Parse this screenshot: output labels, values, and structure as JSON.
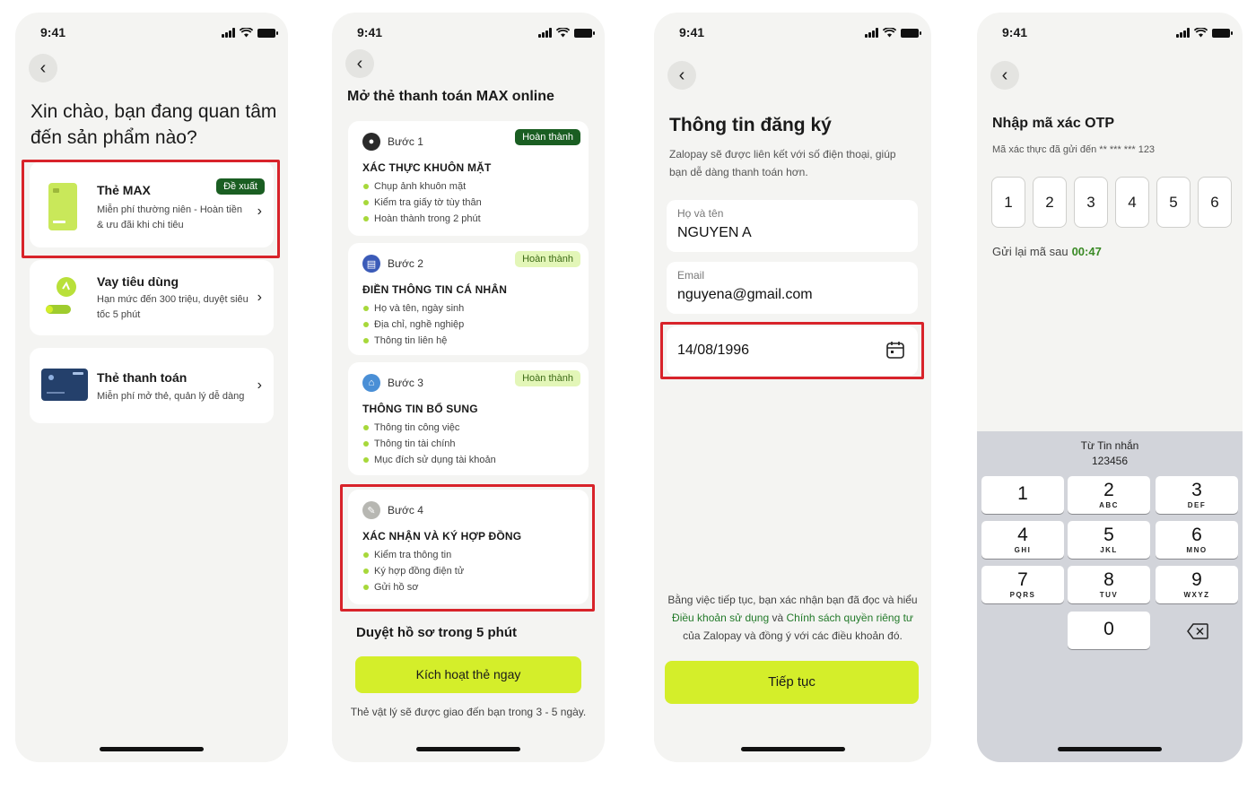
{
  "status_time": "9:41",
  "screen1": {
    "title": "Xin chào, bạn đang quan tâm đến sản phẩm nào?",
    "products": [
      {
        "name": "Thẻ MAX",
        "desc": "Miễn phí thường niên - Hoàn tiền & ưu đãi khi chi tiêu",
        "badge": "Đề xuất"
      },
      {
        "name": "Vay tiêu dùng",
        "desc": "Hạn mức đến 300 triệu, duyệt siêu tốc 5 phút"
      },
      {
        "name": "Thẻ thanh toán",
        "desc": "Miễn phí mở thẻ, quản lý dễ dàng"
      }
    ]
  },
  "screen2": {
    "title": "Mở thẻ thanh toán MAX online",
    "steps": [
      {
        "label": "Bước 1",
        "title": "XÁC THỰC KHUÔN MẶT",
        "status": "Hoàn thành",
        "items": [
          "Chụp ảnh khuôn mặt",
          "Kiểm tra giấy tờ tùy thân",
          "Hoàn thành trong 2 phút"
        ]
      },
      {
        "label": "Bước 2",
        "title": "ĐIỀN THÔNG TIN CÁ NHÂN",
        "status": "Hoàn thành",
        "items": [
          "Họ và tên, ngày sinh",
          "Địa chỉ, nghề nghiệp",
          "Thông tin liên hệ"
        ]
      },
      {
        "label": "Bước 3",
        "title": "THÔNG TIN BỔ SUNG",
        "status": "Hoàn thành",
        "items": [
          "Thông tin công việc",
          "Thông tin tài chính",
          "Mục đích sử dụng tài khoản"
        ]
      },
      {
        "label": "Bước 4",
        "title": "XÁC NHẬN VÀ KÝ HỢP ĐỒNG",
        "items": [
          "Kiểm tra thông tin",
          "Ký hợp đồng điện tử",
          "Gửi hồ sơ"
        ]
      }
    ],
    "review": "Duyệt hồ sơ trong 5 phút",
    "cta": "Kích hoạt thẻ ngay",
    "note": "Thẻ vật lý sẽ được giao đến bạn trong 3 - 5 ngày."
  },
  "screen3": {
    "title": "Thông tin đăng ký",
    "subtitle": "Zalopay sẽ được liên kết với số điện thoại, giúp bạn dễ dàng thanh toán hơn.",
    "name_label": "Họ và tên",
    "name_value": "NGUYEN A",
    "email_label": "Email",
    "email_value": "nguyena@gmail.com",
    "dob_value": "14/08/1996",
    "terms_pre": "Bằng việc tiếp tục, bạn xác nhận bạn đã đọc và hiểu",
    "terms_link1": "Điều khoản sử dụng",
    "terms_and": "và",
    "terms_link2": "Chính sách quyền riêng tư",
    "terms_post": "của Zalopay và đồng ý với các điều khoản đó.",
    "cta": "Tiếp tục"
  },
  "screen4": {
    "title": "Nhập mã xác OTP",
    "subtitle": "Mã xác thực đã gửi đến ** *** *** 123",
    "otp": [
      "1",
      "2",
      "3",
      "4",
      "5",
      "6"
    ],
    "resend_label": "Gửi lại mã sau",
    "resend_timer": "00:47",
    "suggestion_line1": "Từ Tin nhắn",
    "suggestion_line2": "123456",
    "keys": [
      {
        "d": "1",
        "l": ""
      },
      {
        "d": "2",
        "l": "ABC"
      },
      {
        "d": "3",
        "l": "DEF"
      },
      {
        "d": "4",
        "l": "GHI"
      },
      {
        "d": "5",
        "l": "JKL"
      },
      {
        "d": "6",
        "l": "MNO"
      },
      {
        "d": "7",
        "l": "PQRS"
      },
      {
        "d": "8",
        "l": "TUV"
      },
      {
        "d": "9",
        "l": "WXYZ"
      },
      {
        "d": "0",
        "l": ""
      }
    ]
  },
  "colors": {
    "accent_lime": "#d4ee2a",
    "dark_green": "#1a5e22",
    "highlight_red": "#d8232a",
    "link_green": "#237a2a"
  }
}
